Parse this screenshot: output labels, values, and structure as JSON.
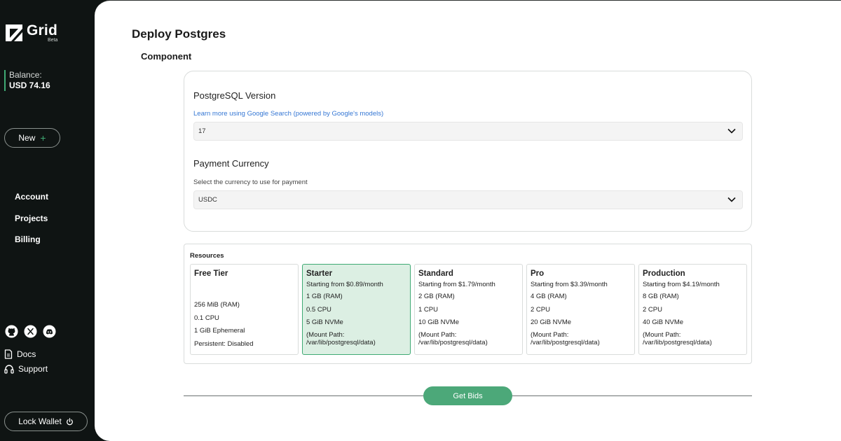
{
  "sidebar": {
    "logo_text": "Grid",
    "logo_badge": "Beta",
    "balance_label": "Balance:",
    "balance_value": "USD 74.16",
    "new_button": "New",
    "nav": [
      "Account",
      "Projects",
      "Billing"
    ],
    "social_icons": [
      "github-icon",
      "x-icon",
      "discord-icon"
    ],
    "links": [
      {
        "label": "Docs",
        "icon": "document-icon"
      },
      {
        "label": "Support",
        "icon": "headset-icon"
      }
    ],
    "lock_button": "Lock Wallet"
  },
  "main": {
    "title": "Deploy Postgres",
    "section": "Component",
    "version": {
      "label": "PostgreSQL Version",
      "help": "Learn more using Google Search (powered by Google's models)",
      "value": "17"
    },
    "currency": {
      "label": "Payment Currency",
      "help": "Select the currency to use for payment",
      "value": "USDC"
    },
    "resources": {
      "title": "Resources",
      "selected": "Starter",
      "tiers": [
        {
          "name": "Free Tier",
          "price": "",
          "specs": [
            "256 MiB (RAM)",
            "0.1 CPU",
            "1 GiB Ephemeral",
            "Persistent: Disabled"
          ]
        },
        {
          "name": "Starter",
          "price": "Starting from $0.89/month",
          "specs": [
            "1 GB (RAM)",
            "0.5 CPU",
            "5 GiB NVMe"
          ],
          "mount": "(Mount Path: /var/lib/postgresql/data)"
        },
        {
          "name": "Standard",
          "price": "Starting from $1.79/month",
          "specs": [
            "2 GB (RAM)",
            "1 CPU",
            "10 GiB NVMe"
          ],
          "mount": "(Mount Path: /var/lib/postgresql/data)"
        },
        {
          "name": "Pro",
          "price": "Starting from $3.39/month",
          "specs": [
            "4 GB (RAM)",
            "2 CPU",
            "20 GiB NVMe"
          ],
          "mount": "(Mount Path: /var/lib/postgresql/data)"
        },
        {
          "name": "Production",
          "price": "Starting from $4.19/month",
          "specs": [
            "8 GB (RAM)",
            "2 CPU",
            "40 GiB NVMe"
          ],
          "mount": "(Mount Path: /var/lib/postgresql/data)"
        }
      ]
    },
    "get_bids_button": "Get Bids"
  },
  "colors": {
    "accent": "#4ca879",
    "selected_bg": "#dcefe3",
    "sidebar_bg": "#0f1413",
    "link": "#3577d4"
  }
}
